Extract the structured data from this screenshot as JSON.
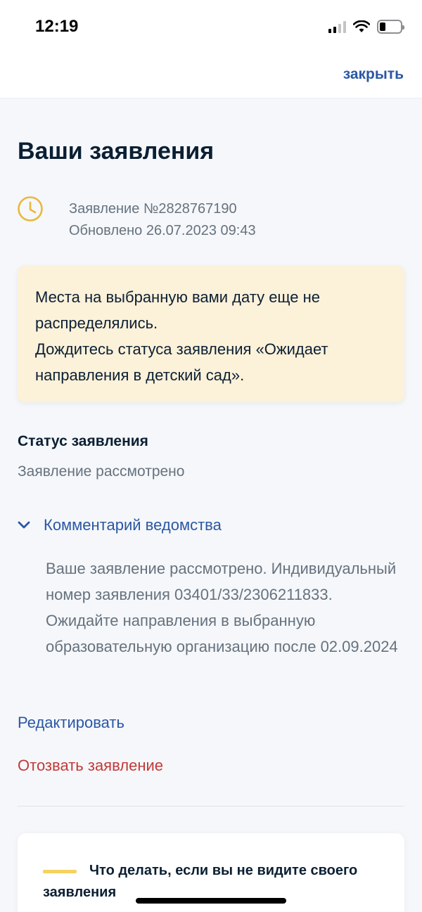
{
  "status_bar": {
    "time": "12:19"
  },
  "nav": {
    "close_label": "закрыть"
  },
  "page": {
    "title": "Ваши заявления"
  },
  "application": {
    "number_line": "Заявление №2828767190",
    "updated_line": "Обновлено 26.07.2023 09:43",
    "status_icon": "clock-icon"
  },
  "notice": {
    "line1": "Места на выбранную вами дату еще не распределялись.",
    "line2": "Дождитесь статуса заявления «Ожидает направления в детский сад»."
  },
  "status": {
    "heading": "Статус заявления",
    "value": "Заявление рассмотрено"
  },
  "comment": {
    "toggle_label": "Комментарий ведомства",
    "text": "Ваше заявление рассмотрено. Индивидуальный номер заявления 03401/33/2306211833. Ожидайте направления в выбранную образовательную организацию после 02.09.2024"
  },
  "actions": {
    "edit_label": "Редактировать",
    "revoke_label": "Отозвать заявление"
  },
  "help": {
    "title": "Что делать, если вы не видите своего заявления"
  },
  "colors": {
    "accent_blue": "#2b57a4",
    "danger_red": "#c13a3a",
    "notice_bg": "#fcf1d9",
    "clock_yellow": "#e9b83c",
    "help_accent": "#f4d35e"
  }
}
